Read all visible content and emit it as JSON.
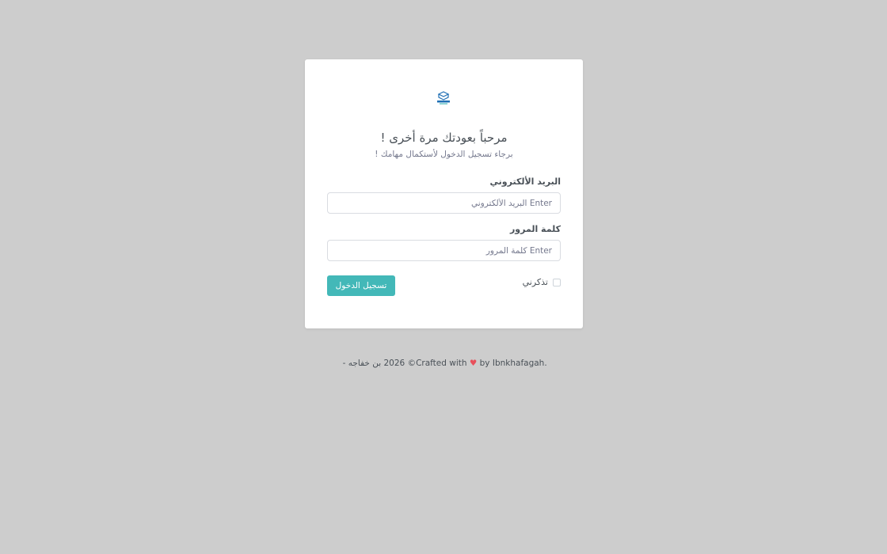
{
  "brand": {
    "logo_icon": "box-logo-icon",
    "accent_color": "#43b8b8"
  },
  "welcome": {
    "title": "مرحباً بعودتك مرة أخرى !",
    "subtitle": "برجاء تسجيل الدخول لأستكمال مهامك !"
  },
  "form": {
    "email_label": "البريد الألكتروني",
    "email_placeholder": "Enter البريد الألكتروني",
    "email_value": "",
    "password_label": "كلمة المرور",
    "password_placeholder": "Enter كلمة المرور",
    "password_value": "",
    "remember_label": "تذكرني",
    "remember_checked": false,
    "submit_label": "تسجيل الدخول"
  },
  "footer": {
    "copyright": "© 2026 بن خفاجه - ",
    "crafted": "Crafted with",
    "heart_icon": "heart-icon",
    "heart_color": "#e8505b",
    "by": "by Ibnkhafagah."
  }
}
